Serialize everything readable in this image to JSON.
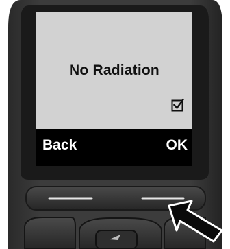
{
  "display": {
    "message": "No Radiation",
    "checkbox_state": "checked"
  },
  "softkeys": {
    "left_label": "Back",
    "right_label": "OK"
  },
  "icons": {
    "checkbox": "checked-checkbox-icon",
    "pointer": "arrow-pointer-icon"
  }
}
